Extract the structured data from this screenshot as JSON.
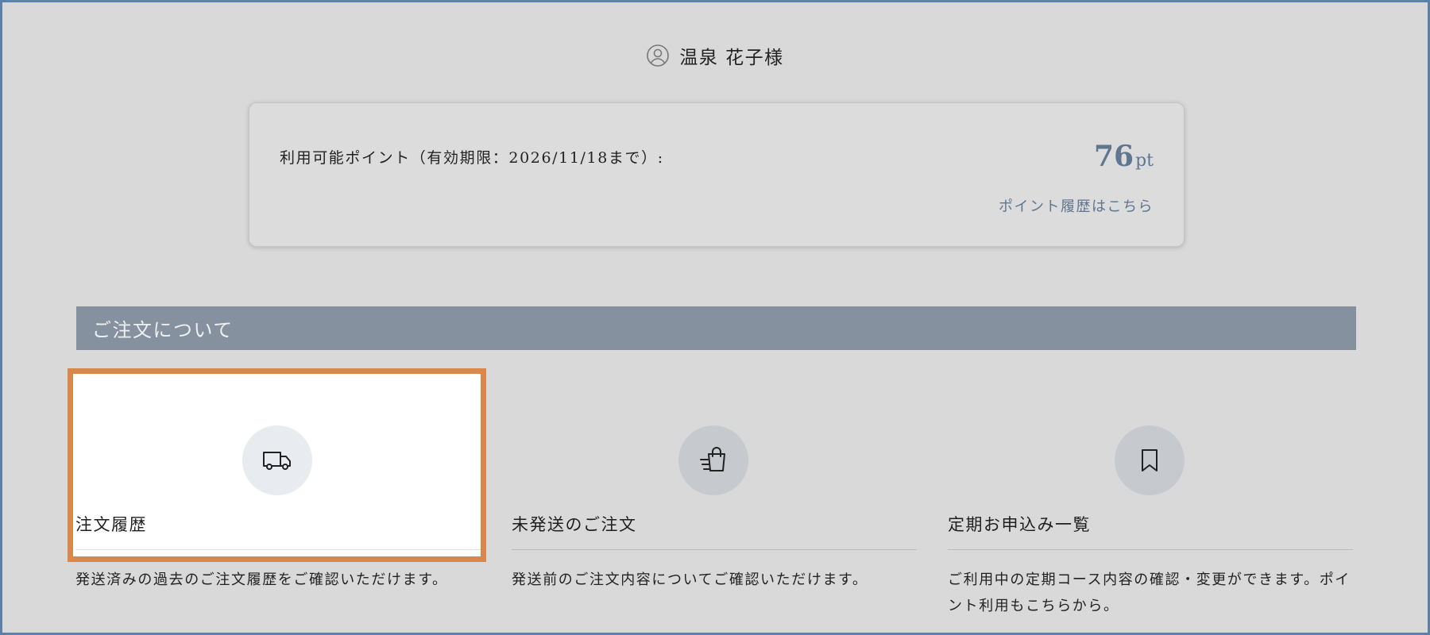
{
  "user": {
    "name": "温泉 花子様",
    "icon": "user-circle-icon"
  },
  "points": {
    "label": "利用可能ポイント（有効期限：2026/11/18まで）:",
    "value": "76",
    "unit": "pt",
    "history_link": "ポイント履歴はこちら"
  },
  "section": {
    "title": "ご注文について"
  },
  "menu": [
    {
      "title": "注文履歴",
      "description": "発送済みの過去のご注文履歴をご確認いただけます。",
      "icon": "truck-icon",
      "selected": true
    },
    {
      "title": "未発送のご注文",
      "description": "発送前のご注文内容についてご確認いただけます。",
      "icon": "shopping-bag-icon",
      "selected": false
    },
    {
      "title": "定期お申込み一覧",
      "description": "ご利用中の定期コース内容の確認・変更ができます。ポイント利用もこちらから。",
      "icon": "bookmark-icon",
      "selected": false
    }
  ],
  "colors": {
    "accent": "#5f7691",
    "selection_outline": "#d9874a",
    "section_header": "#85919e"
  }
}
